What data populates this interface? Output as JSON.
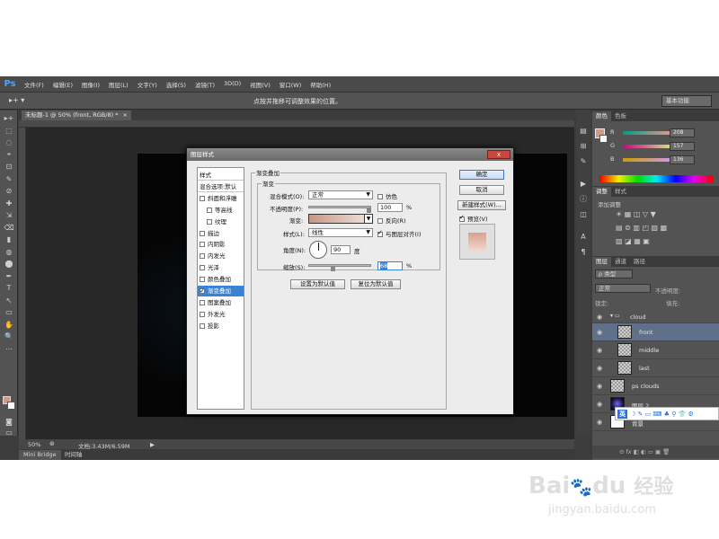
{
  "app": {
    "logo": "Ps",
    "menus": [
      "文件(F)",
      "编辑(E)",
      "图像(I)",
      "图层(L)",
      "文字(Y)",
      "选择(S)",
      "滤镜(T)",
      "3D(D)",
      "视图(V)",
      "窗口(W)",
      "帮助(H)"
    ],
    "options_hint": "点按并拖移可调整效果的位置。",
    "tool_indicator": "▸+ ▾",
    "workspace": "基本功能",
    "doc_tab": "未标题-1 @ 50% (front, RGB/8) *",
    "doc_close": "×"
  },
  "status": {
    "zoom": "50%",
    "doc": "文档:3.43M/6.59M",
    "arrow": "▶",
    "tabs": [
      "Mini Bridge",
      "时间轴"
    ]
  },
  "tools": [
    "▸+",
    "⬚",
    "◌",
    "⌖",
    "⊡",
    "✎",
    "⊘",
    "✚",
    "⇲",
    "⌫",
    "▮",
    "◍",
    "⬤",
    "✒",
    "T",
    "↖",
    "▭",
    "✋",
    "🔍",
    "⋯"
  ],
  "color_panel": {
    "tabs": [
      "颜色",
      "色板"
    ],
    "channels": [
      {
        "label": "R",
        "value": "208",
        "color": "#e04545"
      },
      {
        "label": "G",
        "value": "157",
        "color": "#3fbf6a"
      },
      {
        "label": "B",
        "value": "136",
        "color": "#5c6be0"
      }
    ],
    "fg": "#d09a88"
  },
  "adjust_panel": {
    "tabs": [
      "调整",
      "样式"
    ],
    "hint": "添加调整",
    "row1": "☀ ▦ ◫ ▽ ▼",
    "row2": "▤ ⊜ ▥ ◰ ▨ ▩",
    "row3": "▧ ◪ ▦ ▣"
  },
  "layers_panel": {
    "tabs": [
      "图层",
      "通道",
      "路径"
    ],
    "kind": "ρ 类型",
    "blend": "正常",
    "opacity_label": "不透明度:",
    "lock_label": "锁定:",
    "fill_label": "填充:",
    "group": "cloud",
    "layers": [
      {
        "name": "front",
        "selected": true
      },
      {
        "name": "middle",
        "selected": false
      },
      {
        "name": "last",
        "selected": false
      },
      {
        "name": "ps clouds",
        "selected": false
      },
      {
        "name": "图层 2",
        "selected": false
      },
      {
        "name": "背景",
        "selected": false
      }
    ],
    "footer": "⊝ fx ◧ ◐ ▭ ▣ 🗑"
  },
  "dialog": {
    "title": "图层样式",
    "close": "x",
    "styles": [
      {
        "label": "样式",
        "header": true
      },
      {
        "label": "混合选项:默认",
        "header": true
      },
      {
        "label": "斜面和浮雕",
        "checked": false,
        "indent": 0
      },
      {
        "label": "等高线",
        "checked": false,
        "indent": 1
      },
      {
        "label": "纹理",
        "checked": false,
        "indent": 1
      },
      {
        "label": "描边",
        "checked": false,
        "indent": 0
      },
      {
        "label": "内阴影",
        "checked": false,
        "indent": 0
      },
      {
        "label": "内发光",
        "checked": false,
        "indent": 0
      },
      {
        "label": "光泽",
        "checked": false,
        "indent": 0
      },
      {
        "label": "颜色叠加",
        "checked": false,
        "indent": 0
      },
      {
        "label": "渐变叠加",
        "checked": true,
        "indent": 0,
        "selected": true
      },
      {
        "label": "图案叠加",
        "checked": false,
        "indent": 0
      },
      {
        "label": "外发光",
        "checked": false,
        "indent": 0
      },
      {
        "label": "投影",
        "checked": false,
        "indent": 0
      }
    ],
    "section_title": "渐变叠加",
    "group_title": "渐变",
    "blend_mode_label": "混合模式(O):",
    "blend_mode_value": "正常",
    "dither_label": "仿色",
    "opacity_label": "不透明度(P):",
    "opacity_value": "100",
    "percent": "%",
    "gradient_label": "渐变:",
    "reverse_label": "反向(R)",
    "style_label": "样式(L):",
    "style_value": "线性",
    "align_label": "与图层对齐(I)",
    "angle_label": "角度(N):",
    "angle_value": "90",
    "degree": "度",
    "scale_label": "缩放(S):",
    "scale_value": "68",
    "btn_set_default": "设置为默认值",
    "btn_reset_default": "复位为默认值",
    "btn_ok": "确定",
    "btn_cancel": "取消",
    "btn_new_style": "新建样式(W)...",
    "preview_label": "预览(V)"
  },
  "watermark": {
    "brand": "Bai",
    "brand2": "du",
    "cn": "经验",
    "url": "jingyan.baidu.com"
  },
  "ime": {
    "label": "英",
    "icons": "☽ ✎ ▭ ⌨ ♣ ⚲ 👕 ⚙"
  }
}
